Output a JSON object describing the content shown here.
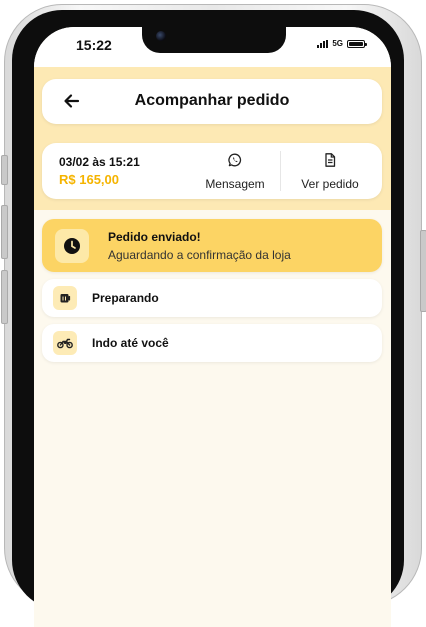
{
  "status_bar": {
    "time": "15:22",
    "network": "5G"
  },
  "header": {
    "title": "Acompanhar pedido",
    "back_icon": "arrow-left-icon"
  },
  "order": {
    "date": "03/02 às 15:21",
    "total": "R$ 165,00",
    "actions": [
      {
        "label": "Mensagem",
        "icon": "whatsapp-icon"
      },
      {
        "label": "Ver pedido",
        "icon": "document-icon"
      }
    ]
  },
  "steps": [
    {
      "title": "Pedido enviado!",
      "subtitle": "Aguardando a confirmação da loja",
      "icon": "clock-icon",
      "active": true
    },
    {
      "title": "Preparando",
      "icon": "box-icon",
      "active": false
    },
    {
      "title": "Indo até você",
      "icon": "motorcycle-icon",
      "active": false
    }
  ],
  "colors": {
    "accent": "#F5B400",
    "active_step_bg": "#FCD464",
    "header_bg": "#FDE9B4",
    "screen_bg": "#FDF9EE"
  }
}
